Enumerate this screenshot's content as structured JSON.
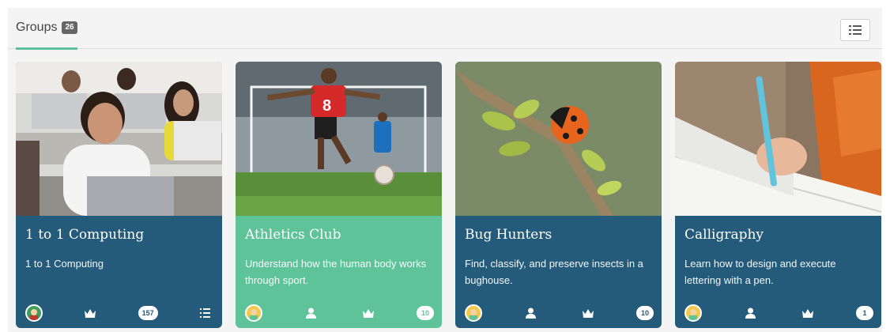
{
  "header": {
    "tab_label": "Groups",
    "tab_count": "26"
  },
  "colors": {
    "accent": "#5bbfa0",
    "card_blue": "#245a7a",
    "card_green": "#5fc39a"
  },
  "cards": [
    {
      "title": "1 to 1 Computing",
      "description": "1 to 1 Computing",
      "image_icon": "students-laptops-photo",
      "footer_icons": [
        "avatar-icon",
        "crown-icon",
        "count-badge",
        "list-icon"
      ],
      "count": "157"
    },
    {
      "title": "Athletics Club",
      "description": "Understand how the human body works through sport.",
      "image_icon": "soccer-photo",
      "footer_icons": [
        "avatar-icon",
        "person-icon",
        "crown-icon",
        "count-badge"
      ],
      "count": "10"
    },
    {
      "title": "Bug Hunters",
      "description": "Find, classify, and preserve insects in a bughouse.",
      "image_icon": "ladybug-photo",
      "footer_icons": [
        "avatar-icon",
        "person-icon",
        "crown-icon",
        "count-badge"
      ],
      "count": "10"
    },
    {
      "title": "Calligraphy",
      "description": "Learn how to design and execute lettering with a pen.",
      "image_icon": "writing-photo",
      "footer_icons": [
        "avatar-icon",
        "person-icon",
        "crown-icon",
        "count-badge"
      ],
      "count": "1"
    }
  ]
}
